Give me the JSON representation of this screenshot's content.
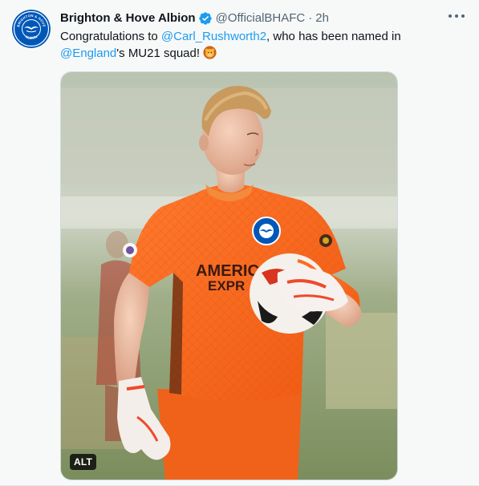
{
  "tweet": {
    "display_name": "Brighton & Hove Albion",
    "handle": "@OfficialBHAFC",
    "separator": "·",
    "time": "2h",
    "text": {
      "part1": "Congratulations to ",
      "mention1": "@Carl_Rushworth2",
      "part2": ", who has been named in ",
      "mention2": "@England",
      "part3": "'s MU21 squad!"
    },
    "emoji_icon": "lion-face-icon",
    "verified_icon": "verified-badge-icon",
    "more_icon": "more-options-icon"
  },
  "avatar": {
    "ring_text_top": "BRIGHTON & HOVE",
    "ring_text_bottom": "ALBION",
    "color": "#0057b8"
  },
  "media": {
    "alt_label": "ALT",
    "shirt_text_line1": "AMERIC",
    "shirt_text_line2": "EXPR",
    "shirt_color": "#ff6a1f"
  },
  "colors": {
    "accent": "#1d9bf0",
    "text": "#0f1419",
    "secondary": "#536471",
    "brand": "#0057b8"
  }
}
